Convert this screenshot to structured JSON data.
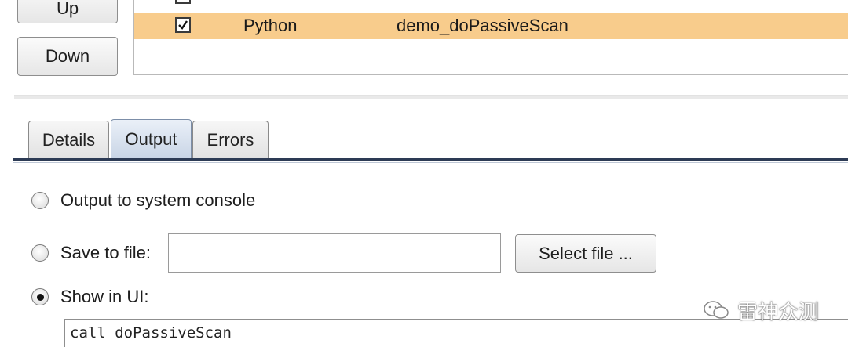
{
  "left_buttons": {
    "up_label": "Up",
    "down_label": "Down"
  },
  "extensions_table": {
    "rows": [
      {
        "checked": true,
        "type": "Python",
        "name": "demo_doPassiveScan",
        "selected": true
      }
    ]
  },
  "tabs": [
    {
      "label": "Details",
      "active": false
    },
    {
      "label": "Output",
      "active": true
    },
    {
      "label": "Errors",
      "active": false
    }
  ],
  "output_options": {
    "system_console_label": "Output to system console",
    "save_to_file_label": "Save to file:",
    "save_to_file_value": "",
    "select_file_label": "Select file ...",
    "show_in_ui_label": "Show in UI:",
    "selected_option": "Show in UI:"
  },
  "console": {
    "text": "call doPassiveScan"
  },
  "watermark": {
    "text": "雷神众测"
  },
  "colors": {
    "selected_row": "#f8cc8c",
    "active_tab": "#c9d5e6",
    "tab_rule": "#2d3b55"
  }
}
